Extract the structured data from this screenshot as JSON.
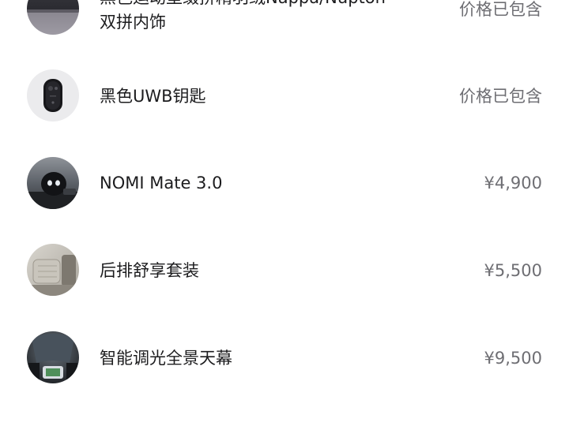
{
  "items": [
    {
      "name_line1": "黑色运动型缀拼精羽绒Nappa/Nupton",
      "name_line2": "双拼内饰",
      "price": "价格已包含",
      "icon": "seat-interior-icon"
    },
    {
      "name": "黑色UWB钥匙",
      "price": "价格已包含",
      "icon": "uwb-key-icon"
    },
    {
      "name": "NOMI Mate 3.0",
      "price": "¥4,900",
      "icon": "nomi-mate-icon"
    },
    {
      "name": "后排舒享套装",
      "price": "¥5,500",
      "icon": "rear-seat-package-icon"
    },
    {
      "name": "智能调光全景天幕",
      "price": "¥9,500",
      "icon": "panoramic-sunroof-icon"
    }
  ]
}
